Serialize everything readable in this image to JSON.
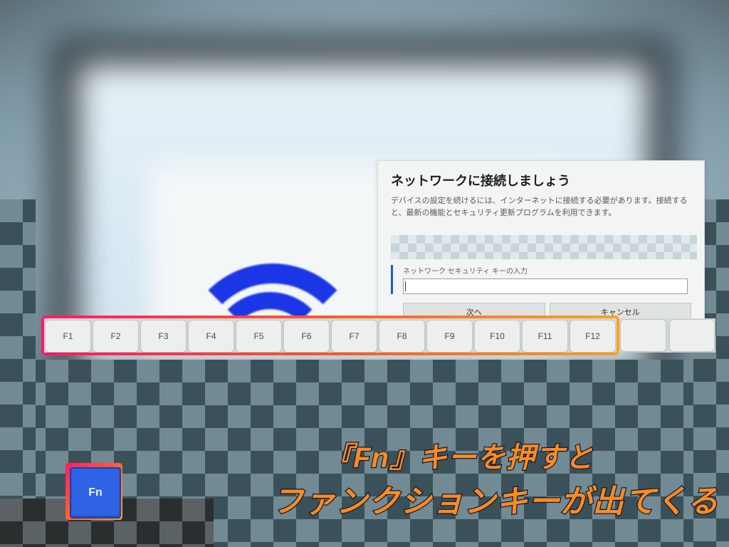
{
  "dialog": {
    "title": "ネットワークに接続しましょう",
    "description": "デバイスの設定を続けるには、インターネットに接続する必要があります。接続すると、最新の機能とセキュリティ更新プログラムを利用できます。",
    "field_label": "ネットワーク セキュリティ キーの入力",
    "field_value": "",
    "next_label": "次へ",
    "cancel_label": "キャンセル"
  },
  "fkeys": [
    "F1",
    "F2",
    "F3",
    "F4",
    "F5",
    "F6",
    "F7",
    "F8",
    "F9",
    "F10",
    "F11",
    "F12"
  ],
  "fn_key_label": "Fn",
  "annotation": {
    "line1": "『Fn』キーを押すと",
    "line2": "ファンクションキーが出てくる"
  }
}
